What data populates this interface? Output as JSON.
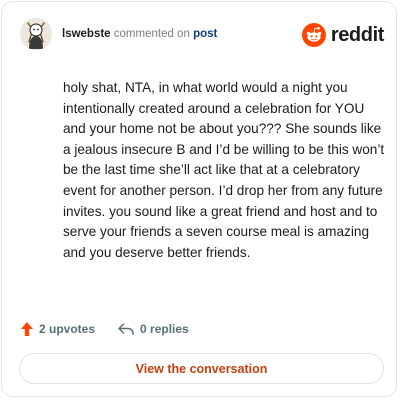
{
  "comment": {
    "username": "lswebste",
    "action_text": "commented on",
    "post_link": "post",
    "avatar_icon": "user-avatar",
    "body": "holy shat, NTA, in what world would a night you intentionally created around a celebration for YOU and your home not be about you??? She sounds like a jealous insecure B and I’d be willing to be this won’t be the last time she’ll act like that at a celebratory event for another person. I’d drop her from any future invites. you sound like a great friend and host and to serve your friends a seven course meal is amazing and you deserve better friends."
  },
  "brand": {
    "name": "reddit",
    "icon": "reddit-snoo-icon",
    "color": "#ff4500"
  },
  "stats": {
    "upvotes": "2 upvotes",
    "upvote_icon": "upvote-arrow-icon",
    "replies": "0 replies",
    "reply_icon": "reply-arrow-icon"
  },
  "cta": {
    "label": "View the conversation",
    "color": "#c2410c"
  }
}
